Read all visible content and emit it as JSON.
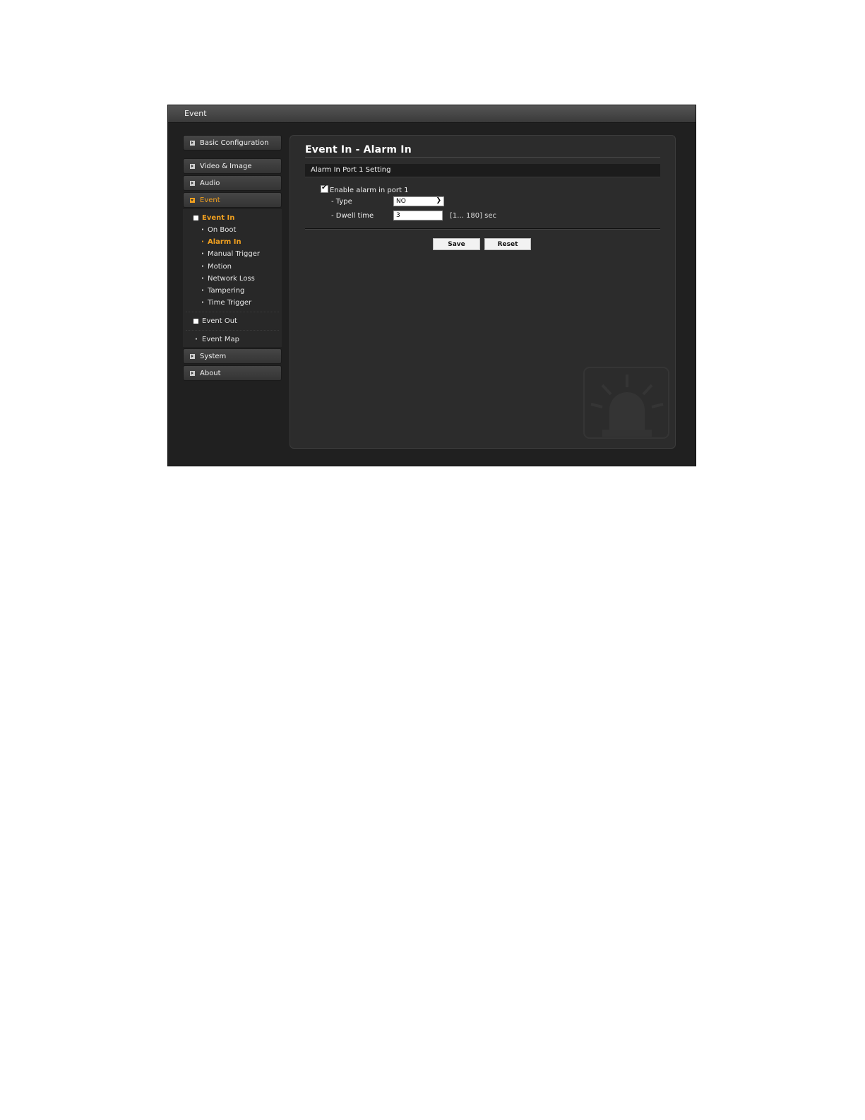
{
  "window": {
    "title": "Event"
  },
  "sidebar": {
    "menu": {
      "basic": "Basic Configuration",
      "video": "Video & Image",
      "audio": "Audio",
      "event": "Event",
      "system": "System",
      "about": "About"
    },
    "event_in": {
      "label": "Event In",
      "items": [
        "On Boot",
        "Alarm In",
        "Manual Trigger",
        "Motion",
        "Network Loss",
        "Tampering",
        "Time Trigger"
      ],
      "active_item": "Alarm In"
    },
    "event_out": "Event Out",
    "event_map": "Event Map"
  },
  "main": {
    "title": "Event In - Alarm In",
    "section": "Alarm In Port 1 Setting",
    "enable_label": "Enable alarm in port 1",
    "enable_checked": true,
    "type_label": "- Type",
    "type_value": "NO",
    "dwell_label": "- Dwell time",
    "dwell_value": "3",
    "dwell_range": "[1... 180] sec",
    "save": "Save",
    "reset": "Reset"
  },
  "colors": {
    "accent": "#f0a020",
    "background": "#202020",
    "panel": "#2c2c2c"
  },
  "icons": {
    "menu_arrow": "arrow-right-square-icon",
    "watermark": "alarm-siren-icon"
  }
}
